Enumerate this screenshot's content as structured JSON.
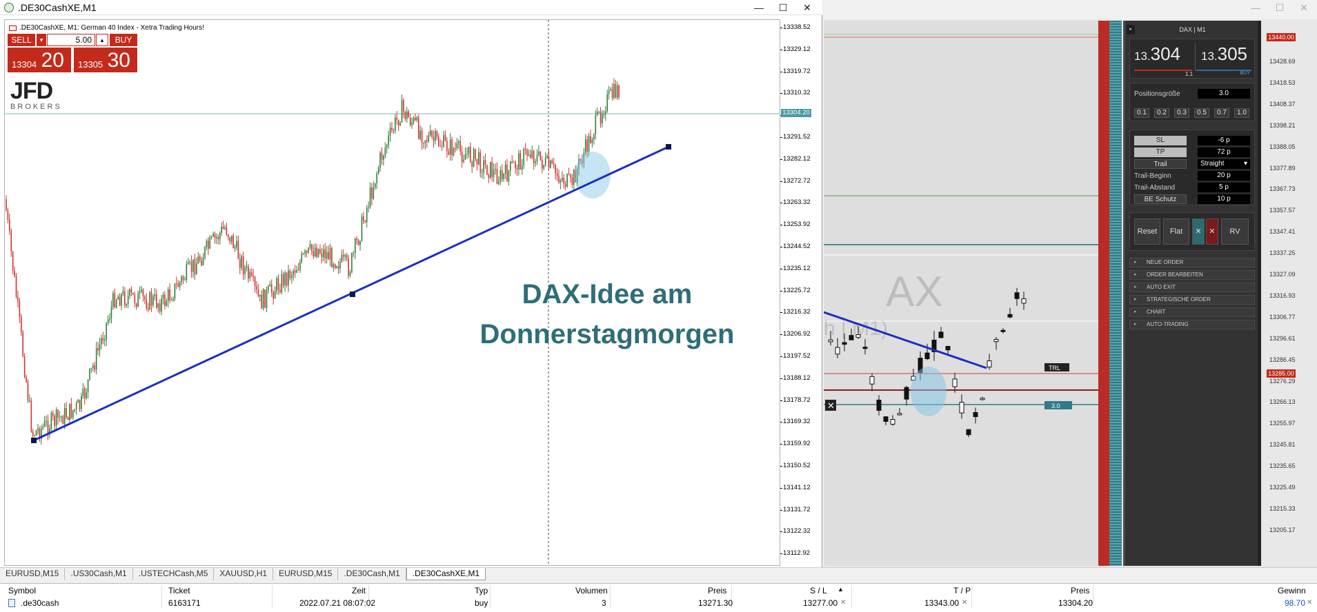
{
  "left_window": {
    "title": ".DE30CashXE,M1",
    "controls": {
      "minimize": "—",
      "maximize": "☐",
      "close": "✕"
    },
    "chart_header": ".DE30CashXE, M1:  German 40 Index  - Xetra Trading Hours!",
    "trade_panel": {
      "sell_label": "SELL",
      "buy_label": "BUY",
      "lot_value": "5.00",
      "sell_price_small": "13304",
      "sell_price_big": "20",
      "buy_price_small": "13305",
      "buy_price_big": "30"
    },
    "logo": {
      "top": "JFD",
      "bottom": "BROKERS"
    },
    "overlay_text_line1": "DAX-Idee am",
    "overlay_text_line2": "Donnerstagmorgen",
    "current_price_tag": "13304.20",
    "price_axis": [
      "13338.52",
      "13329.12",
      "13319.72",
      "13310.32",
      "13300.92",
      "13291.52",
      "13282.12",
      "13272.72",
      "13263.32",
      "13253.92",
      "13244.52",
      "13235.12",
      "13225.72",
      "13216.32",
      "13206.92",
      "13197.52",
      "13188.12",
      "13178.72",
      "13169.32",
      "13159.92",
      "13150.52",
      "13141.12",
      "13131.72",
      "13122.32",
      "13112.92"
    ]
  },
  "right_window": {
    "controls": {
      "minimize": "—",
      "maximize": "☐",
      "close": "✕"
    },
    "watermark_main": "AX",
    "watermark_sub": "h | M1)",
    "trl_label": "TRL",
    "pos_label": "3.0",
    "sidebar": {
      "title": "DAX | M1",
      "bid_small": "13.",
      "bid_big": "304",
      "ask_small": "13.",
      "ask_big": "305",
      "spread": "1.1",
      "buy_small": "BUY",
      "position_size_label": "Positionsgröße",
      "position_size_value": "3.0",
      "lot_presets": [
        "0.1",
        "0.2",
        "0.3",
        "0.5",
        "0.7",
        "1.0"
      ],
      "sl_label": "SL",
      "sl_value": "-6 p",
      "tp_label": "TP",
      "tp_value": "72 p",
      "trail_label": "Trail",
      "trail_value": "Straight",
      "trail_begin_label": "Trail-Beginn",
      "trail_begin_value": "20 p",
      "trail_distance_label": "Trail-Abstand",
      "trail_distance_value": "5 p",
      "be_label": "BE Schutz",
      "be_value": "10 p",
      "actions": {
        "reset": "Reset",
        "flat": "Flat",
        "x1": "✕",
        "x2": "✕",
        "rv": "RV"
      },
      "menu": [
        "NEUE ORDER",
        "ORDER BEARBEITEN",
        "AUTO EXIT",
        "STRATEGISCHE ORDER",
        "CHART",
        "AUTO-TRADING"
      ]
    },
    "price_axis": [
      "13428.69",
      "13418.53",
      "13408.37",
      "13398.21",
      "13388.05",
      "13377.89",
      "13367.73",
      "13357.57",
      "13347.41",
      "13337.25",
      "13327.09",
      "13316.93",
      "13306.77",
      "13296.61",
      "13286.45",
      "13276.29",
      "13266.13",
      "13255.97",
      "13245.81",
      "13235.65",
      "13225.49",
      "13215.33",
      "13205.17"
    ],
    "tag_top": "13440.00",
    "tag_mid": "13285.00"
  },
  "tabs": [
    "EURUSD,M15",
    ".US30Cash,M1",
    ".USTECHCash,M5",
    "XAUUSD,H1",
    "EURUSD,M15",
    ".DE30Cash,M1",
    ".DE30CashXE,M1"
  ],
  "active_tab": 6,
  "table": {
    "headers": {
      "symbol": "Symbol",
      "ticket": "Ticket",
      "zeit": "Zeit",
      "typ": "Typ",
      "volumen": "Volumen",
      "preis": "Preis",
      "sl": "S / L",
      "tp": "T / P",
      "preis2": "Preis",
      "gewinn": "Gewinn"
    },
    "row": {
      "symbol": ".de30cash",
      "ticket": "6163171",
      "zeit": "2022.07.21 08:07:02",
      "typ": "buy",
      "volumen": "3",
      "preis": "13271.30",
      "sl": "13277.00",
      "tp": "13343.00",
      "preis2": "13304.20",
      "gewinn": "98.70"
    }
  },
  "colors": {
    "bull": "#2e7d32",
    "bear": "#d32f2f",
    "trend": "#1a2fbf",
    "overlay": "#2e6e78",
    "sell": "#c42a1b"
  }
}
